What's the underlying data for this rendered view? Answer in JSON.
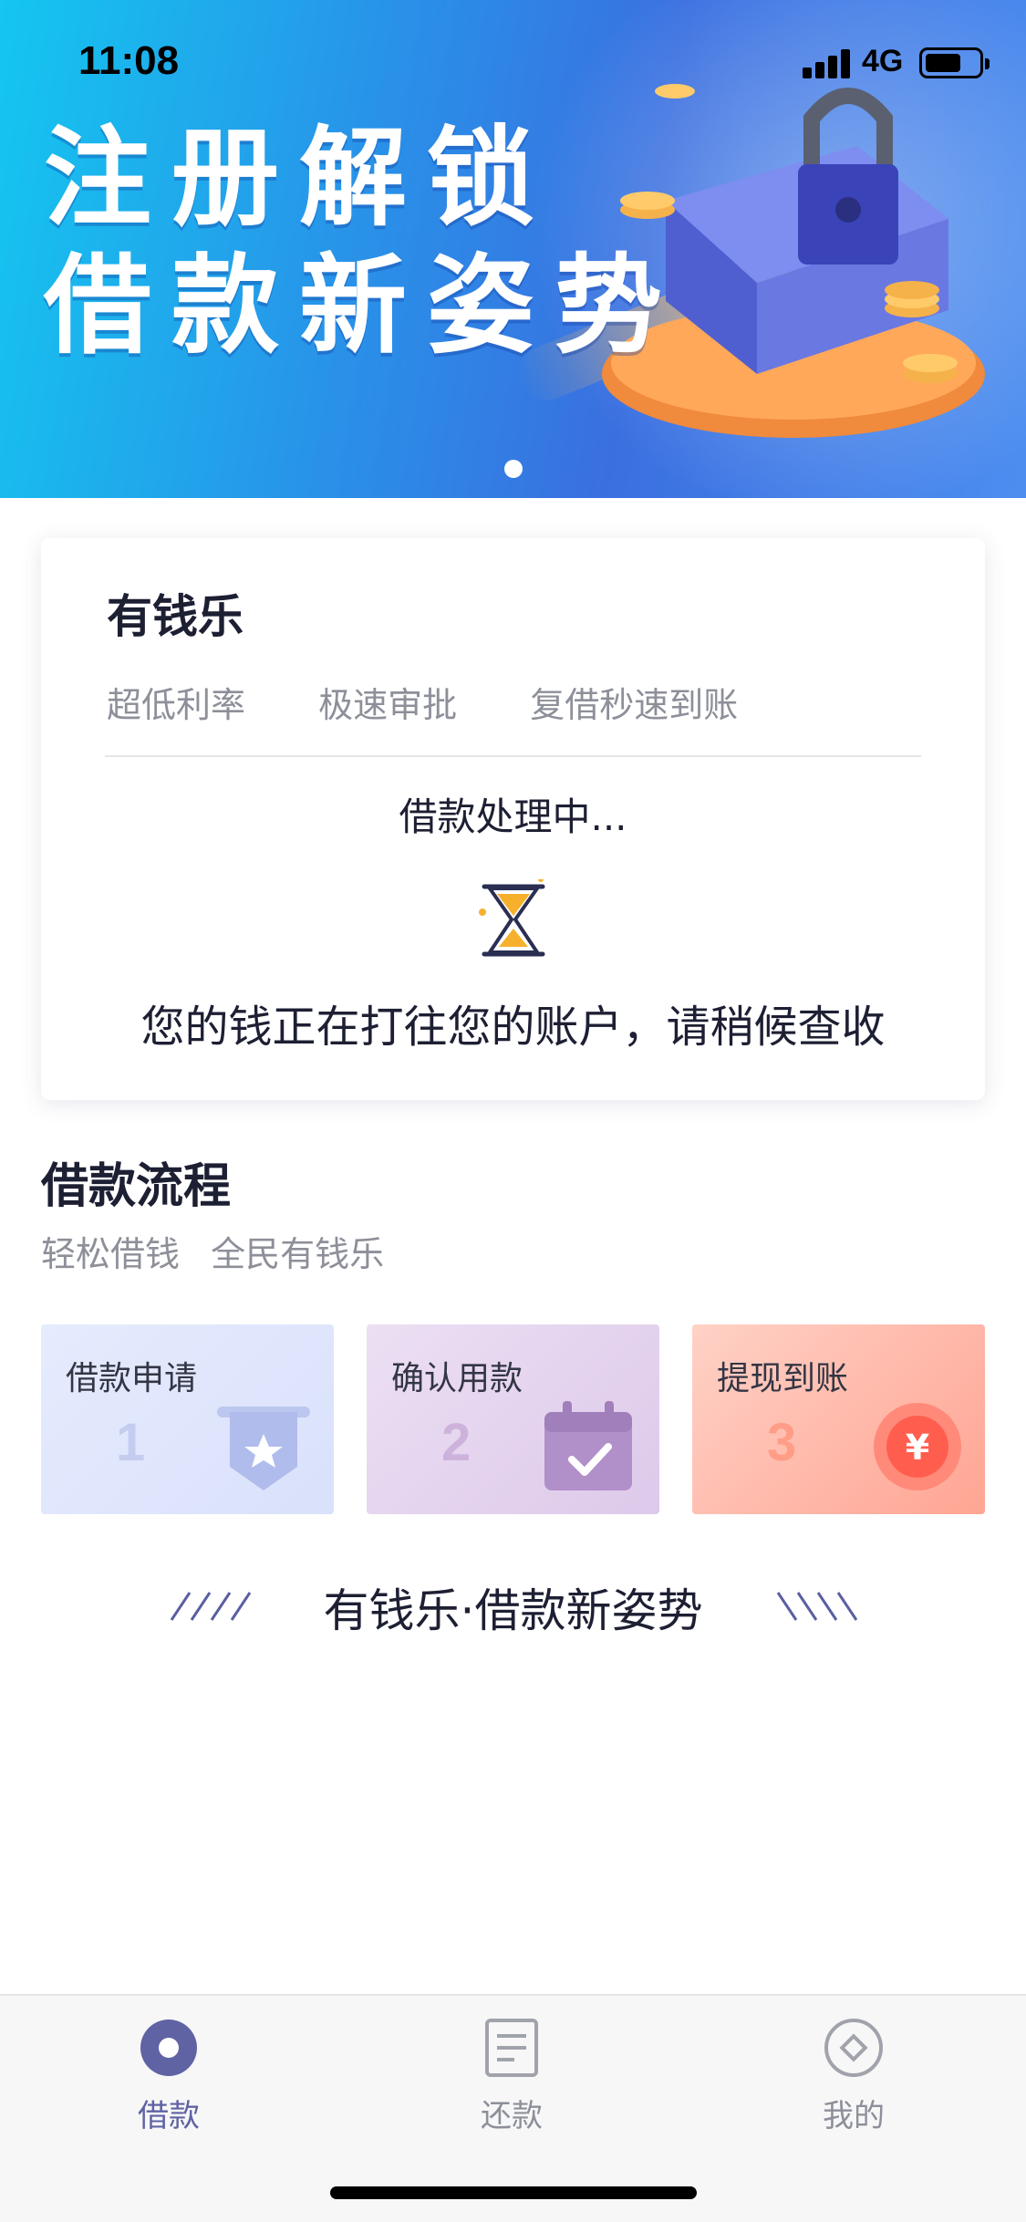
{
  "status_bar": {
    "time": "11:08",
    "network": "4G"
  },
  "banner": {
    "title_line1": "注册解锁",
    "title_line2": "借款新姿势",
    "indicator_count": 1
  },
  "card": {
    "title": "有钱乐",
    "features": [
      "超低利率",
      "极速审批",
      "复借秒速到账"
    ],
    "processing": "借款处理中...",
    "message": "您的钱正在打往您的账户，请稍候查收"
  },
  "process": {
    "title": "借款流程",
    "subtitle": [
      "轻松借钱",
      "全民有钱乐"
    ],
    "steps": [
      {
        "label": "借款申请",
        "number": "1",
        "icon": "star-shield-icon"
      },
      {
        "label": "确认用款",
        "number": "2",
        "icon": "calendar-check-icon"
      },
      {
        "label": "提现到账",
        "number": "3",
        "icon": "yuan-coin-icon"
      }
    ]
  },
  "slogan": "有钱乐·借款新姿势",
  "tabbar": {
    "items": [
      {
        "label": "借款",
        "icon": "loan-icon",
        "active": true
      },
      {
        "label": "还款",
        "icon": "document-icon",
        "active": false
      },
      {
        "label": "我的",
        "icon": "profile-icon",
        "active": false
      }
    ],
    "active_color": "#5f63a3",
    "inactive_color": "#8d8f99"
  }
}
